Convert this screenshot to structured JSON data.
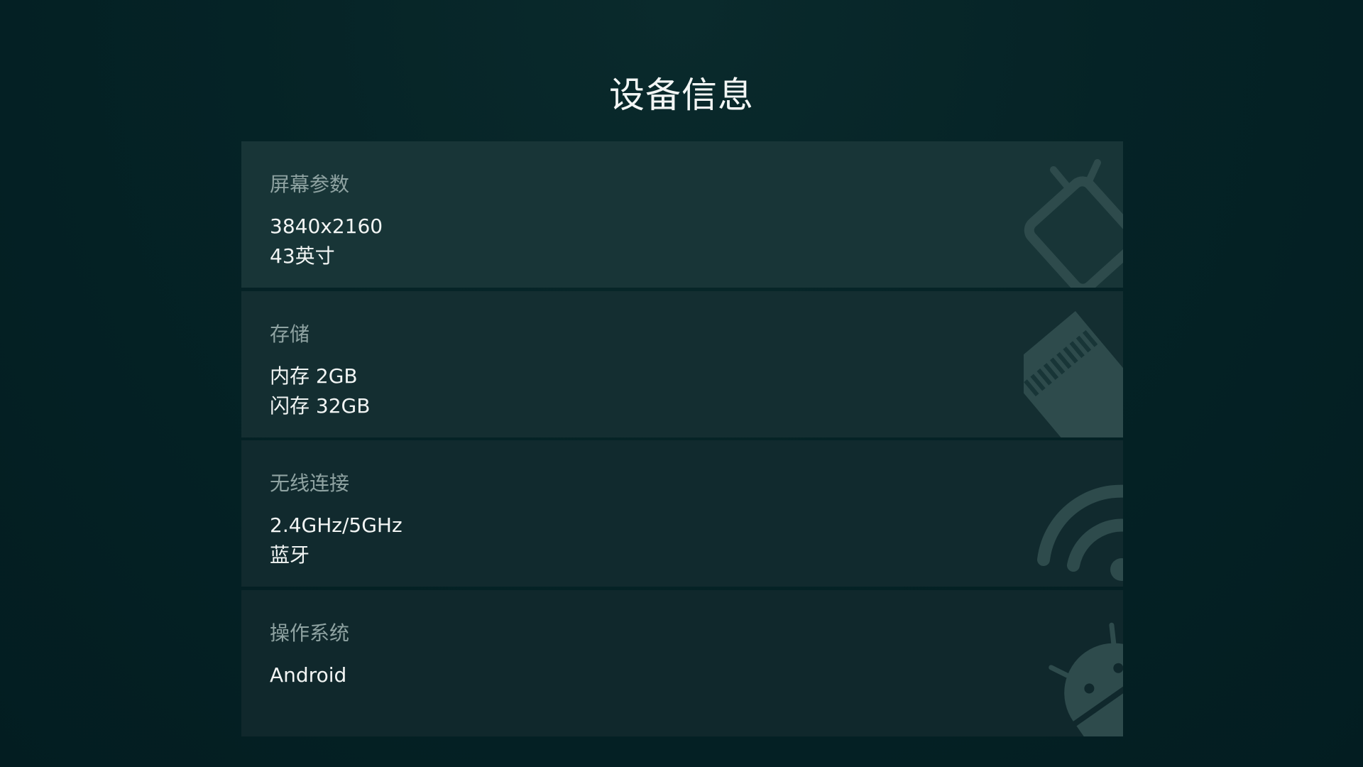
{
  "title": "设备信息",
  "colors": {
    "background": "#031d21",
    "card": "#183537",
    "label": "#8fa3a2",
    "value": "#f2f5f4",
    "art": "#2e4b4c"
  },
  "cards": [
    {
      "label": "屏幕参数",
      "values": [
        "3840x2160",
        "43英寸"
      ],
      "icon": "tv-icon"
    },
    {
      "label": "存储",
      "values": [
        "内存 2GB",
        "闪存 32GB"
      ],
      "icon": "sd-card-icon"
    },
    {
      "label": "无线连接",
      "values": [
        "2.4GHz/5GHz",
        "蓝牙"
      ],
      "icon": "wifi-icon"
    },
    {
      "label": "操作系统",
      "values": [
        "Android"
      ],
      "icon": "android-icon"
    }
  ]
}
